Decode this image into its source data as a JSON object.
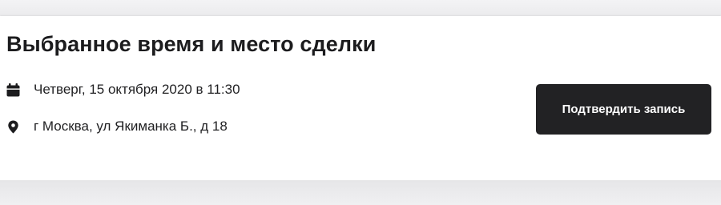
{
  "section": {
    "title": "Выбранное время и место сделки"
  },
  "details": {
    "date": {
      "icon": "calendar-icon",
      "text": "Четверг, 15 октября 2020 в 11:30"
    },
    "location": {
      "icon": "map-pin-icon",
      "text": "г Москва, ул Якиманка Б., д 18"
    }
  },
  "actions": {
    "confirm_label": "Подтвердить запись"
  },
  "colors": {
    "button_background": "#222224",
    "text_primary": "#1c1c1e",
    "page_background": "#eeeef0"
  }
}
